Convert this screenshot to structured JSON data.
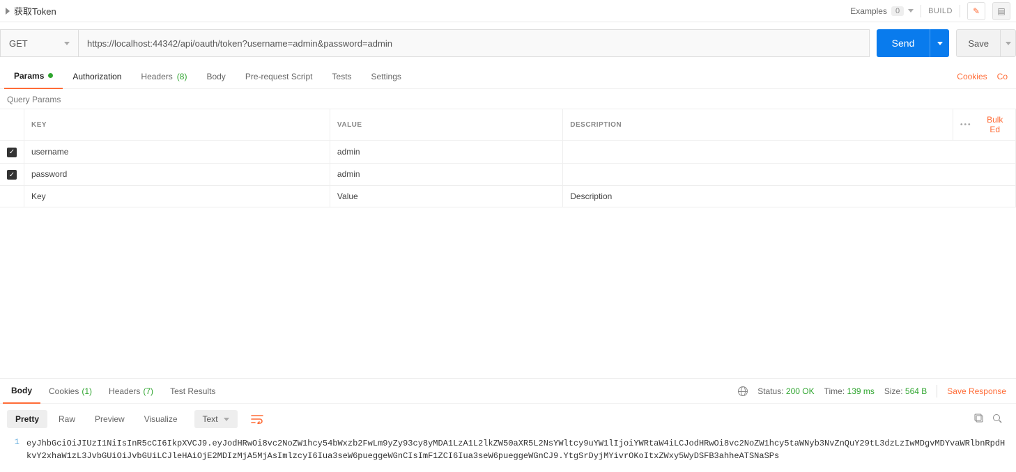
{
  "topbar": {
    "title": "获取Token",
    "examples_label": "Examples",
    "examples_count": "0",
    "build_label": "BUILD"
  },
  "request": {
    "method": "GET",
    "url": "https://localhost:44342/api/oauth/token?username=admin&password=admin",
    "send_label": "Send",
    "save_label": "Save"
  },
  "req_tabs": {
    "params": "Params",
    "authorization": "Authorization",
    "headers": "Headers",
    "headers_count": "(8)",
    "body": "Body",
    "prerequest": "Pre-request Script",
    "tests": "Tests",
    "settings": "Settings",
    "cookies": "Cookies",
    "code": "Co"
  },
  "params_section": {
    "title": "Query Params",
    "col_key": "KEY",
    "col_value": "VALUE",
    "col_desc": "DESCRIPTION",
    "bulk_label": "Bulk Ed",
    "rows": [
      {
        "key": "username",
        "value": "admin"
      },
      {
        "key": "password",
        "value": "admin"
      }
    ],
    "ph_key": "Key",
    "ph_value": "Value",
    "ph_desc": "Description"
  },
  "resp_tabs": {
    "body": "Body",
    "cookies": "Cookies",
    "cookies_count": "(1)",
    "headers": "Headers",
    "headers_count": "(7)",
    "test_results": "Test Results"
  },
  "resp_meta": {
    "status_label": "Status:",
    "status_value": "200 OK",
    "time_label": "Time:",
    "time_value": "139 ms",
    "size_label": "Size:",
    "size_value": "564 B",
    "save_response": "Save Response"
  },
  "viewer": {
    "pretty": "Pretty",
    "raw": "Raw",
    "preview": "Preview",
    "visualize": "Visualize",
    "mode": "Text"
  },
  "response_body": {
    "lineno": "1",
    "text": "eyJhbGciOiJIUzI1NiIsInR5cCI6IkpXVCJ9.eyJodHRwOi8vc2NoZW1hcy54bWxzb2FwLm9yZy93cy8yMDA1LzA1L2lkZW50aXR5L2NsYWltcy9uYW1lIjoiYWRtaW4iLCJodHRwOi8vc2NoZW1hcy5taWNyb3NvZnQuY29tL3dzLzIwMDgvMDYvaWRlbnRpdHkvY2xhaW1zL3JvbGUiOiJvbGUiLCJleHAiOjE2MDIzMjA5MjAsImlzcyI6Iua3seW6pueggeWGnCIsImF1ZCI6Iua3seW6pueggeWGnCJ9.YtgSrDyjMYivrOKoItxZWxy5WyDSFB3ahheATSNaSPs"
  }
}
